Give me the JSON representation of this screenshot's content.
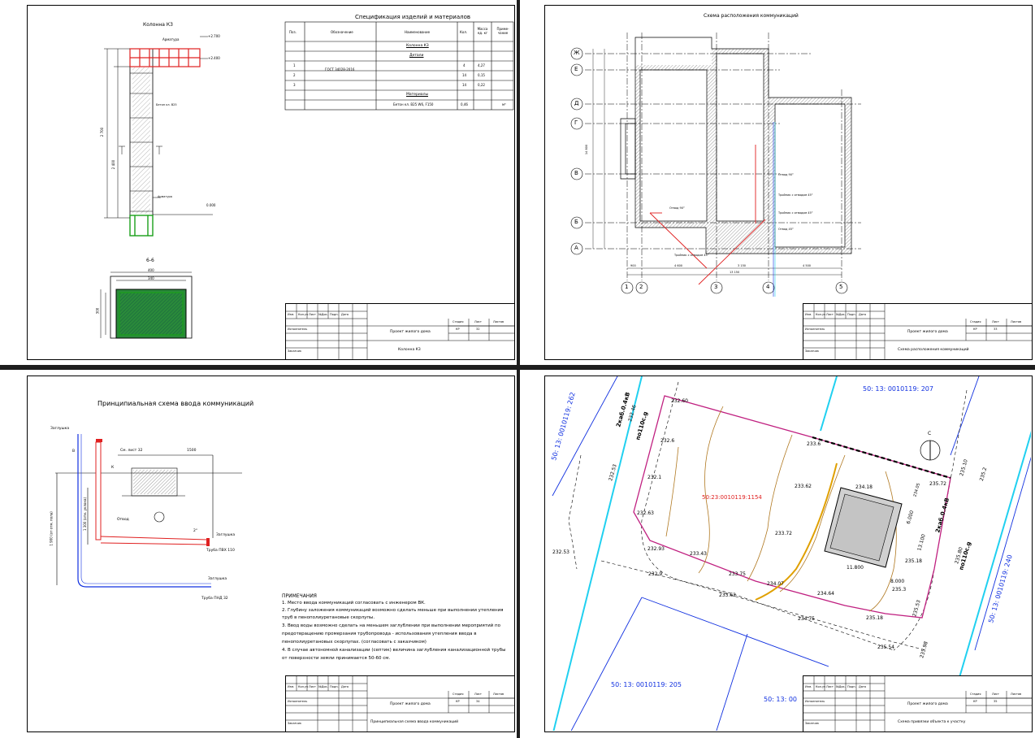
{
  "sheets": {
    "column": {
      "title": "Колонна К3",
      "section_label": "6-6",
      "labels": {
        "armature": "Арматура",
        "top_mark": "+2.700",
        "mark2": "+2.400",
        "bottom_mark": "0.000",
        "dim_total": "2 700",
        "dim_part": "2 400",
        "dim_top": "300",
        "dim_bottom": "300",
        "sec_w1": "400",
        "sec_w2": "340",
        "sec_h": "300",
        "note_a": "Бетон кл. В25",
        "note_b": "Арматура",
        "pos1": "1",
        "pos2": "2",
        "pos3": "3"
      },
      "stamp": {
        "project": "Проект жилого дома",
        "sheet_name": "Колонна К3",
        "stage": "КР",
        "sheet": "32"
      }
    },
    "spec": {
      "title": "Спецификация изделий и материалов",
      "headers": [
        "Поз.",
        "Обозначение",
        "Наименование",
        "Кол.",
        "Масса ед. кг",
        "Приме-чание"
      ],
      "group1": "Колонна К3",
      "group2": "Детали",
      "rows": [
        {
          "pos": "1",
          "code": "ГОСТ 34028-2016",
          "name": "",
          "qty": "4",
          "mass": "4,27",
          "note": ""
        },
        {
          "pos": "2",
          "code": "",
          "name": "",
          "qty": "14",
          "mass": "0,15",
          "note": ""
        },
        {
          "pos": "3",
          "code": "",
          "name": "",
          "qty": "14",
          "mass": "0,22",
          "note": ""
        }
      ],
      "group3": "Материалы",
      "material": {
        "name": "Бетон кл. В25 W6, F150",
        "qty": "0,46",
        "unit": "м³"
      }
    },
    "plan": {
      "title": "Схема расположения коммуникаций",
      "axes_letters": [
        "Ж",
        "Е",
        "Д",
        "Г",
        "В",
        "Б",
        "А"
      ],
      "axes_numbers": [
        "1",
        "2",
        "3",
        "4",
        "5"
      ],
      "dims_bottom": [
        "900",
        "4 600",
        "3 150",
        "4 500"
      ],
      "dim_total": "13 150",
      "dims_left": [
        "900",
        "2 600",
        "1 200",
        "3 100",
        "3 000",
        "1 200"
      ],
      "dim_left_total": "14 800",
      "notes": [
        "Отвод 90°",
        "Тройник с отводом 45°",
        "Тройник с отводом 45°",
        "Отвод 90°",
        "Отвод 45°",
        "Тройник с отводом 45°"
      ],
      "stamp": {
        "project": "Проект жилого дома",
        "sheet_name": "Схема расположения коммуникаций",
        "stage": "КР",
        "sheet": "33"
      }
    },
    "scheme": {
      "title": "Принципиальная схема ввода коммуникаций",
      "labels": {
        "zaglushka1": "Заглушка",
        "zaglushka2": "Заглушка",
        "zaglushka3": "Заглушка",
        "sm_list": "См. лист 32",
        "dim1500": "1500",
        "pipe1": "Труба ПВХ 110",
        "pipe2": "Труба ПНД 32",
        "otvod": "Отвод",
        "k": "К",
        "b": "В",
        "dim1900": "1 900 (от отм. пола)",
        "dim1300": "1 300 (отм. уклона)",
        "slope": "2°"
      },
      "notes_title": "ПРИМЕЧАНИЯ",
      "notes": [
        "1. Место ввода коммуникаций согласовать с инженером ВК.",
        "2. Глубину заложения коммуникаций возможно сделать меньше при выполнении утепления",
        "труб в пенополиуретановые скорлупы.",
        "3. Ввод воды возможно сделать на меньшем заглублении при выполнении мероприятий по",
        "предотвращению промерзания трубопровода - использования утепления ввода в",
        "пенополиуретановых скорлупах. (согласовать с заказчиком)",
        "4. В случае автономной канализации (септик) величина заглубления канализационной трубы",
        "от поверхности земли принимается 50-60 см."
      ],
      "stamp": {
        "project": "Проект жилого дома",
        "sheet_name": "Принципиальная схема ввода коммуникаций",
        "stage": "КР",
        "sheet": "34"
      }
    },
    "site": {
      "cadastral_main": "50:23:0010119:1154",
      "cad_top_right": "50: 13: 0010119: 207",
      "cad_top_left": "50: 13: 0010119: 262",
      "cad_right": "50: 13: 0010119: 240",
      "cad_bottom": "50: 13: 0010119: 205",
      "cad_bottom2": "50: 13: 00",
      "cable_labels": [
        "2каб.0.4кВ",
        "по110с.g",
        "2каб.0.4кВ",
        "по110с.g"
      ],
      "elevations": [
        "232.60",
        "232.46",
        "232.6",
        "232.53",
        "232.1",
        "232.63",
        "232.53",
        "232.93",
        "233.43",
        "232.9",
        "233.62",
        "233.75",
        "234.07",
        "234.64",
        "234.75",
        "235.18",
        "235.54",
        "235.3",
        "235.53",
        "235.98",
        "235.18",
        "235.80",
        "235.2",
        "235.72",
        "235.10",
        "234.18",
        "233.62",
        "233.72",
        "233.6",
        "234.05",
        "11.800",
        "8.000",
        "13.100",
        "6.000"
      ],
      "north": "С",
      "stamp": {
        "project": "Проект жилого дома",
        "sheet_name": "Схема привязки объекта к участку",
        "stage": "КР",
        "sheet": "35"
      }
    },
    "stamp_headers": [
      "Изм.",
      "Кол.уч",
      "Лист",
      "№Док.",
      "Подп.",
      "Дата"
    ],
    "stamp_roles": [
      "Исполнитель",
      "Заказчик"
    ],
    "stamp_cols": [
      "Стадия",
      "Лист",
      "Листов"
    ]
  },
  "colors": {
    "red": "#e02020",
    "green": "#1aa01a",
    "blue": "#1030e0",
    "cyan": "#20d0f0",
    "brown": "#b07820",
    "orange": "#e0a000",
    "separator": "#1e1e1e"
  }
}
